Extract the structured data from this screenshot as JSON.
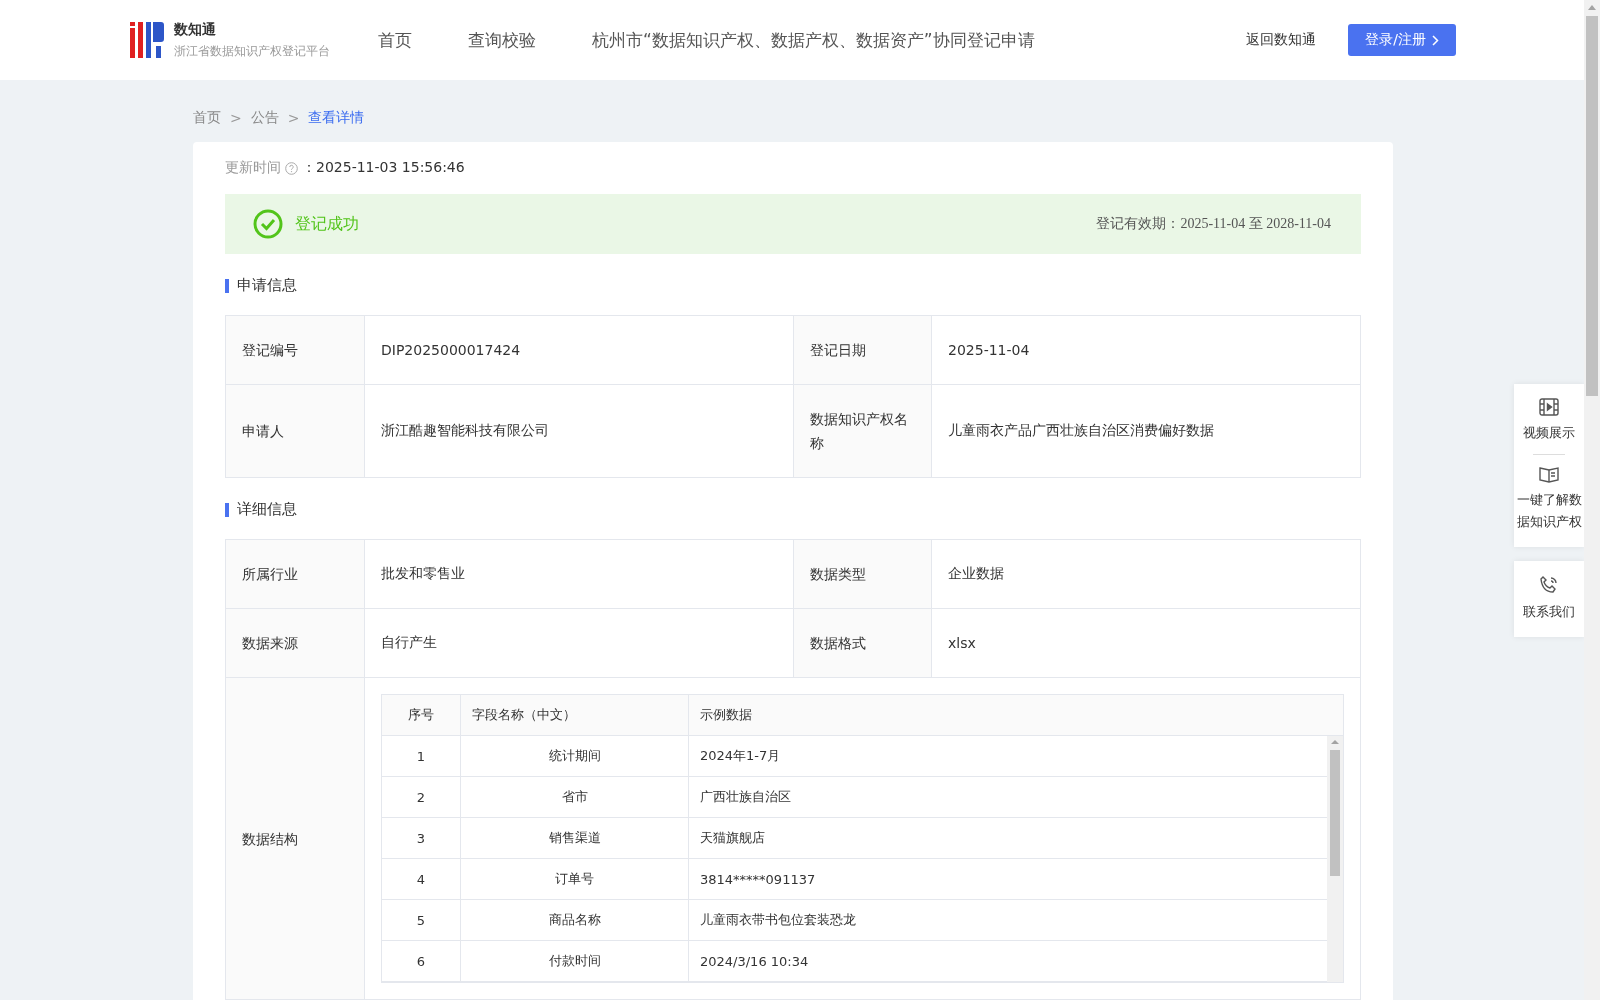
{
  "header": {
    "logo": {
      "title": "数知通",
      "subtitle": "浙江省数据知识产权登记平台"
    },
    "nav": [
      "首页",
      "查询校验",
      "杭州市“数据知识产权、数据产权、数据资产”协同登记申请"
    ],
    "back_link": "返回数知通",
    "login_button": "登录/注册"
  },
  "breadcrumb": [
    {
      "label": "首页",
      "selected": false
    },
    {
      "separator": ">",
      "label": "公告",
      "selected": false
    },
    {
      "separator": ">",
      "label": "查看详情",
      "selected": true
    }
  ],
  "update": {
    "label": "更新时间",
    "colon": "：",
    "value": "2025-11-03 15:56:46"
  },
  "status": {
    "text": "登记成功",
    "validity": "登记有效期：2025-11-04 至 2028-11-04"
  },
  "sections": [
    {
      "title": "申请信息",
      "rows": [
        {
          "kind": "pair",
          "cells": [
            {
              "label": "登记编号",
              "value": "DIP2025000017424"
            },
            {
              "label": "登记日期",
              "value": "2025-11-04"
            }
          ]
        },
        {
          "kind": "pair",
          "cells": [
            {
              "label": "申请人",
              "value": "浙江酷趣智能科技有限公司"
            },
            {
              "label": "数据知识产权名称",
              "value": "儿童雨衣产品广西壮族自治区消费偏好数据"
            }
          ]
        }
      ]
    },
    {
      "title": "详细信息",
      "rows": [
        {
          "kind": "pair",
          "cells": [
            {
              "label": "所属行业",
              "value": "批发和零售业"
            },
            {
              "label": "数据类型",
              "value": "企业数据"
            }
          ]
        },
        {
          "kind": "pair",
          "cells": [
            {
              "label": "数据来源",
              "value": "自行产生"
            },
            {
              "label": "数据格式",
              "value": "xlsx"
            }
          ]
        },
        {
          "kind": "structure",
          "label": "数据结构",
          "table": {
            "columns": [
              "序号",
              "字段名称（中文）",
              "示例数据"
            ],
            "rows": [
              [
                "1",
                "统计期间",
                "2024年1-7月"
              ],
              [
                "2",
                "省市",
                "广西壮族自治区"
              ],
              [
                "3",
                "销售渠道",
                "天猫旗舰店"
              ],
              [
                "4",
                "订单号",
                "3814*****091137"
              ],
              [
                "5",
                "商品名称",
                "儿童雨衣带书包位套装恐龙"
              ],
              [
                "6",
                "付款时间",
                "2024/3/16 10:34"
              ]
            ]
          }
        }
      ]
    }
  ],
  "side_panel": [
    [
      {
        "kind": "video",
        "label": "视频展示"
      },
      {
        "kind": "book",
        "label": "一键了解数据知识产权"
      }
    ],
    [
      {
        "kind": "phone",
        "label": "联系我们"
      }
    ]
  ]
}
